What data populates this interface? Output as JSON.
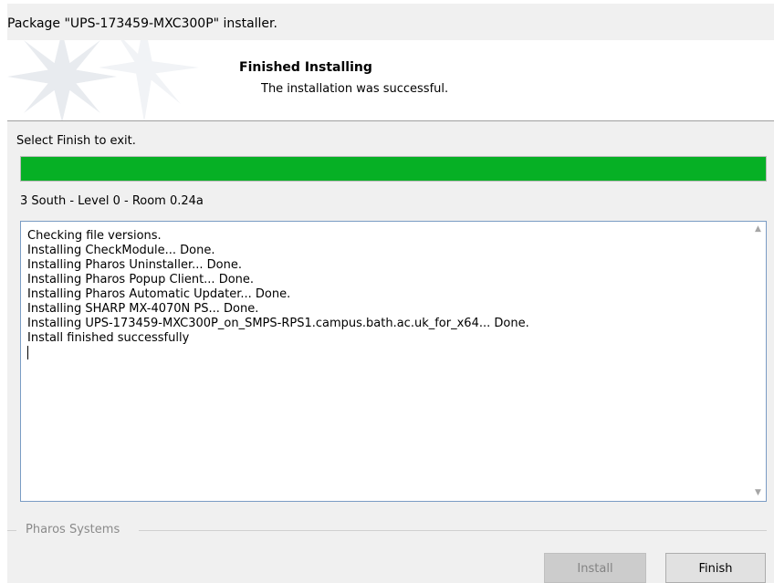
{
  "window": {
    "title": "Package \"UPS-173459-MXC300P\" installer."
  },
  "banner": {
    "heading": "Finished Installing",
    "subtitle": "The installation was successful."
  },
  "instruction": "Select Finish to exit.",
  "progress": {
    "percent": 100,
    "color": "#06b025"
  },
  "location": "3 South - Level 0 - Room 0.24a",
  "log": {
    "lines": [
      "Checking file versions.",
      "Installing CheckModule... Done.",
      "Installing Pharos Uninstaller... Done.",
      "Installing Pharos Popup Client... Done.",
      "Installing Pharos Automatic Updater... Done.",
      "Installing SHARP MX-4070N PS... Done.",
      "Installing UPS-173459-MXC300P_on_SMPS-RPS1.campus.bath.ac.uk_for_x64... Done.",
      "Install finished successfully"
    ]
  },
  "footer": {
    "brand": "Pharos Systems",
    "install_label": "Install",
    "finish_label": "Finish"
  }
}
